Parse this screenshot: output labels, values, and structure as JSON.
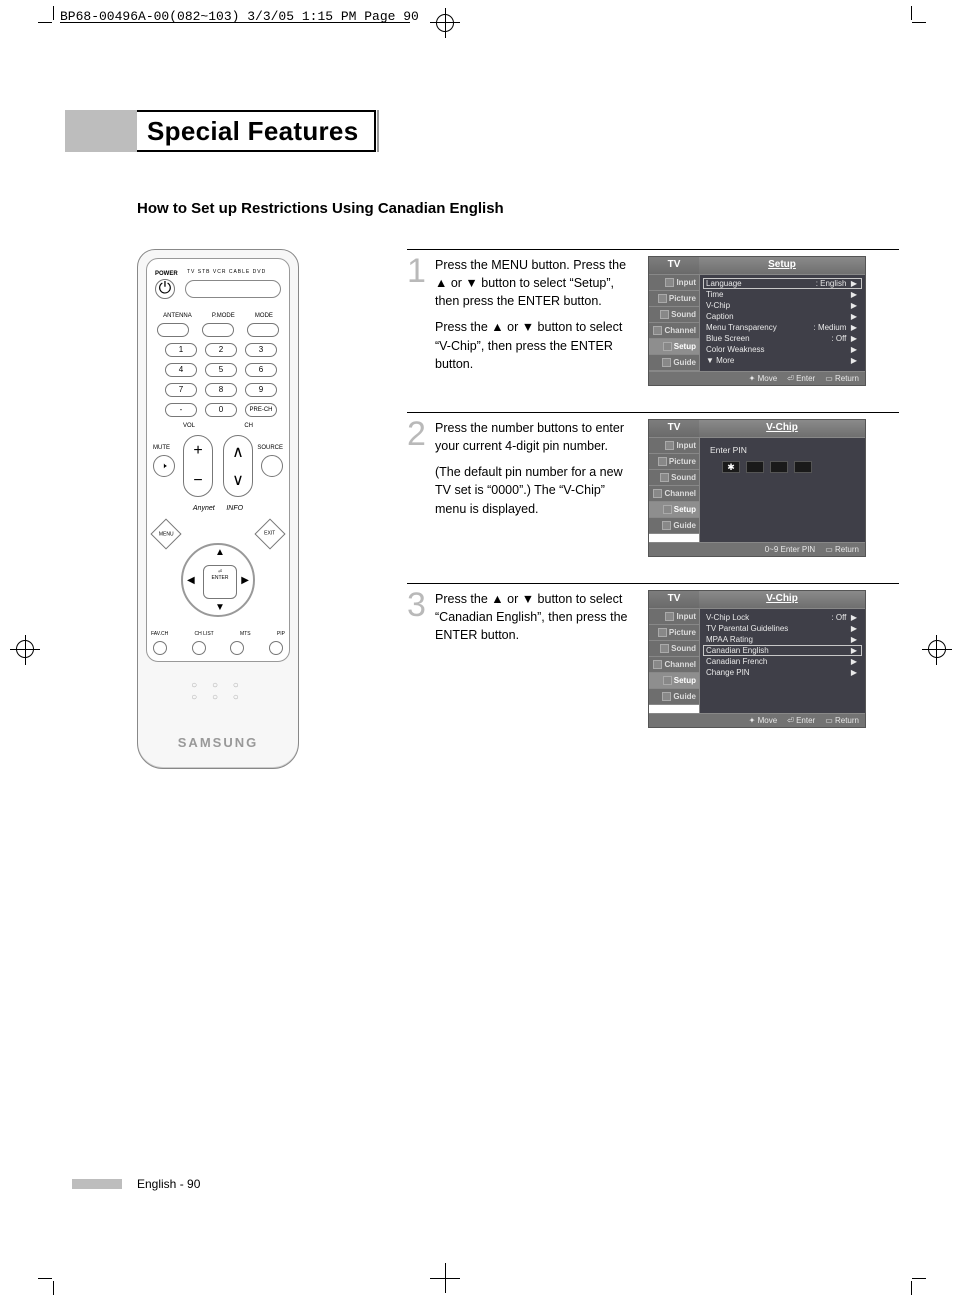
{
  "slug": "BP68-00496A-00(082~103)  3/3/05  1:15 PM  Page 90",
  "header_title": "Special Features",
  "subhead": "How to Set up Restrictions Using Canadian English",
  "footer": "English - 90",
  "remote": {
    "power": "POWER",
    "modes": "TV  STB  VCR  CABLE  DVD",
    "row_lbls": [
      "ANTENNA",
      "P.MODE",
      "MODE"
    ],
    "nums": [
      "1",
      "2",
      "3",
      "4",
      "5",
      "6",
      "7",
      "8",
      "9",
      "-",
      "0",
      "PRE-CH"
    ],
    "vol": "VOL",
    "ch": "CH",
    "mute": "MUTE",
    "source": "SOURCE",
    "anynet": "Anynet",
    "info": "INFO",
    "menu": "MENU",
    "exit": "EXIT",
    "enter": "ENTER",
    "bot": [
      "FAV.CH",
      "CH LIST",
      "MTS",
      "PIP"
    ],
    "brand": "SAMSUNG"
  },
  "steps": {
    "s1": {
      "num": "1",
      "p1": "Press the MENU button. Press the ▲ or ▼ button to select “Setup”, then press the ENTER button.",
      "p2": "Press the ▲ or ▼ button to select “V-Chip”, then press the ENTER button."
    },
    "s2": {
      "num": "2",
      "p1": "Press the number buttons to enter your current 4-digit pin number.",
      "p2": "(The default pin number for a new TV set is “0000”.) The “V-Chip” menu is displayed."
    },
    "s3": {
      "num": "3",
      "p1": "Press the ▲ or ▼ button to select “Canadian English”, then press the ENTER button."
    }
  },
  "osd_common": {
    "tv": "TV",
    "tabs": [
      "Input",
      "Picture",
      "Sound",
      "Channel",
      "Setup",
      "Guide"
    ],
    "move": "Move",
    "enter": "Enter",
    "return": "Return",
    "enterpin": "0~9 Enter PIN"
  },
  "osd1": {
    "title": "Setup",
    "items": [
      {
        "l": "Language",
        "v": ": English"
      },
      {
        "l": "Time",
        "v": ""
      },
      {
        "l": "V-Chip",
        "v": ""
      },
      {
        "l": "Caption",
        "v": ""
      },
      {
        "l": "Menu Transparency",
        "v": ": Medium"
      },
      {
        "l": "Blue Screen",
        "v": ": Off"
      },
      {
        "l": "Color Weakness",
        "v": ""
      },
      {
        "l": "▼ More",
        "v": ""
      }
    ]
  },
  "osd2": {
    "title": "V-Chip",
    "enterpin": "Enter PIN",
    "star": "✱"
  },
  "osd3": {
    "title": "V-Chip",
    "items": [
      {
        "l": "V-Chip Lock",
        "v": ": Off"
      },
      {
        "l": "TV Parental Guidelines",
        "v": ""
      },
      {
        "l": "MPAA Rating",
        "v": ""
      },
      {
        "l": "Canadian English",
        "v": ""
      },
      {
        "l": "Canadian French",
        "v": ""
      },
      {
        "l": "Change PIN",
        "v": ""
      }
    ]
  }
}
